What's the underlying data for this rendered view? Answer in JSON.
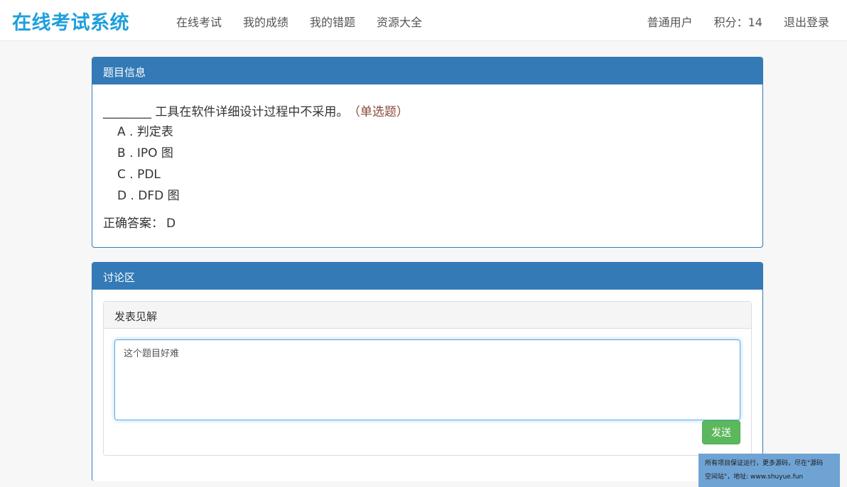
{
  "navbar": {
    "brand": "在线考试系统",
    "links": [
      "在线考试",
      "我的成绩",
      "我的错题",
      "资源大全"
    ],
    "user": "普通用户",
    "points_label": "积分：",
    "points_value": "14",
    "logout": "退出登录"
  },
  "question_panel": {
    "title": "题目信息",
    "question": "________ 工具在软件详细设计过程中不采用。",
    "type": "（单选题）",
    "options": [
      "A . 判定表",
      "B . IPO 图",
      "C . PDL",
      "D . DFD 图"
    ],
    "answer_label": "正确答案：",
    "answer_value": "D"
  },
  "discussion_panel": {
    "title": "讨论区",
    "compose_title": "发表见解",
    "comment_value": "这个题目好难",
    "send_label": "发送"
  },
  "watermark": {
    "line1": "所有项目保证运行，更多源码，尽在\"源码",
    "line2": "空间站\"，地址: www.shuyue.fun"
  },
  "colors": {
    "brand": "#1e9fdc",
    "panel_primary": "#337ab7",
    "success_button": "#5cb85c",
    "question_type": "#8a4a3a"
  }
}
